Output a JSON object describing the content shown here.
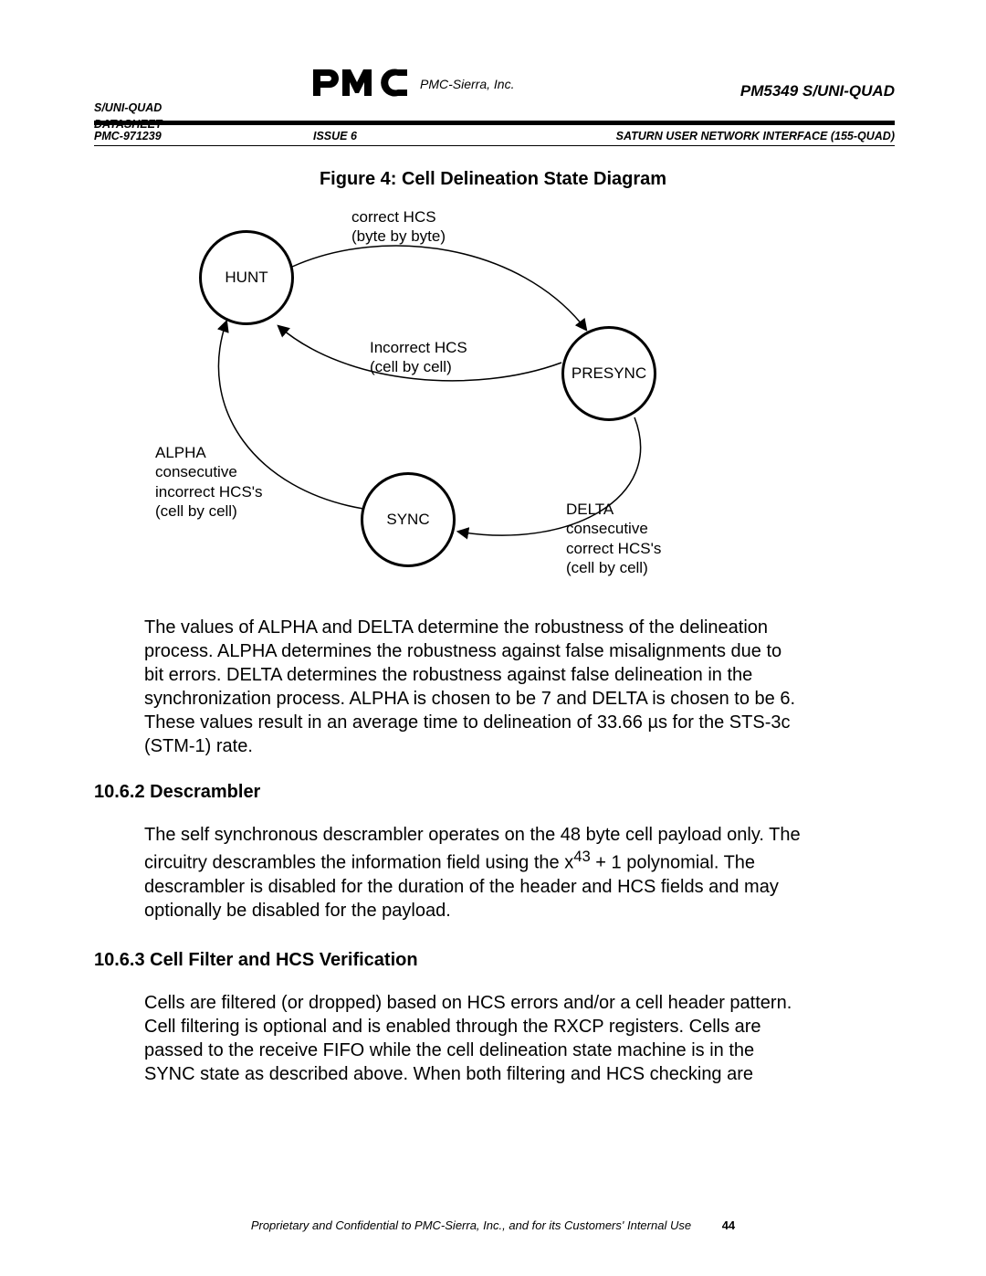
{
  "header": {
    "left1": "S/UNI-QUAD",
    "left2": "DATASHEET",
    "company": "PMC-Sierra, Inc.",
    "right": "PM5349 S/UNI-QUAD",
    "doc_id": "PMC-971239",
    "issue": "ISSUE 6",
    "product": "SATURN USER NETWORK INTERFACE (155-QUAD)"
  },
  "figure": {
    "title": "Figure 4:  Cell Delineation State Diagram",
    "hunt": "HUNT",
    "presync": "PRESYNC",
    "sync": "SYNC",
    "correct1": "correct HCS",
    "correct2": "(byte by byte)",
    "incorrect1": "Incorrect HCS",
    "incorrect2": "(cell by cell)",
    "alpha1": "ALPHA",
    "alpha2": "consecutive",
    "alpha3": "incorrect HCS's",
    "alpha4": "(cell by cell)",
    "delta1": "DELTA",
    "delta2": "consecutive",
    "delta3": "correct HCS's",
    "delta4": "(cell by cell)"
  },
  "para1": "The values of ALPHA and DELTA determine the robustness of the delineation process.  ALPHA determines the robustness against false misalignments due to bit errors.  DELTA determines the robustness against false delineation in the synchronization process.  ALPHA is chosen to be 7 and DELTA is chosen to be 6.  These values result in an average time to delineation of 33.66 µs for the STS-3c (STM-1) rate.",
  "heading1": "10.6.2 Descrambler",
  "para2_a": "The self synchronous descrambler operates on the 48 byte cell payload only.  The circuitry descrambles the information field using the x",
  "para2_exp": "43",
  "para2_b": " + 1 polynomial.  The descrambler is disabled for the duration of the header and HCS fields and may optionally be disabled for the payload.",
  "heading2": "10.6.3 Cell Filter and HCS Verification",
  "para3": "Cells are filtered (or dropped) based on HCS errors and/or a cell header pattern.  Cell filtering is optional and is enabled through the RXCP registers.  Cells are passed to the receive FIFO while the cell delineation state machine is in the SYNC state as described above.  When both filtering and HCS checking are",
  "footer": {
    "text": "Proprietary and Confidential to PMC-Sierra, Inc., and for its Customers' Internal Use",
    "page": "44"
  }
}
